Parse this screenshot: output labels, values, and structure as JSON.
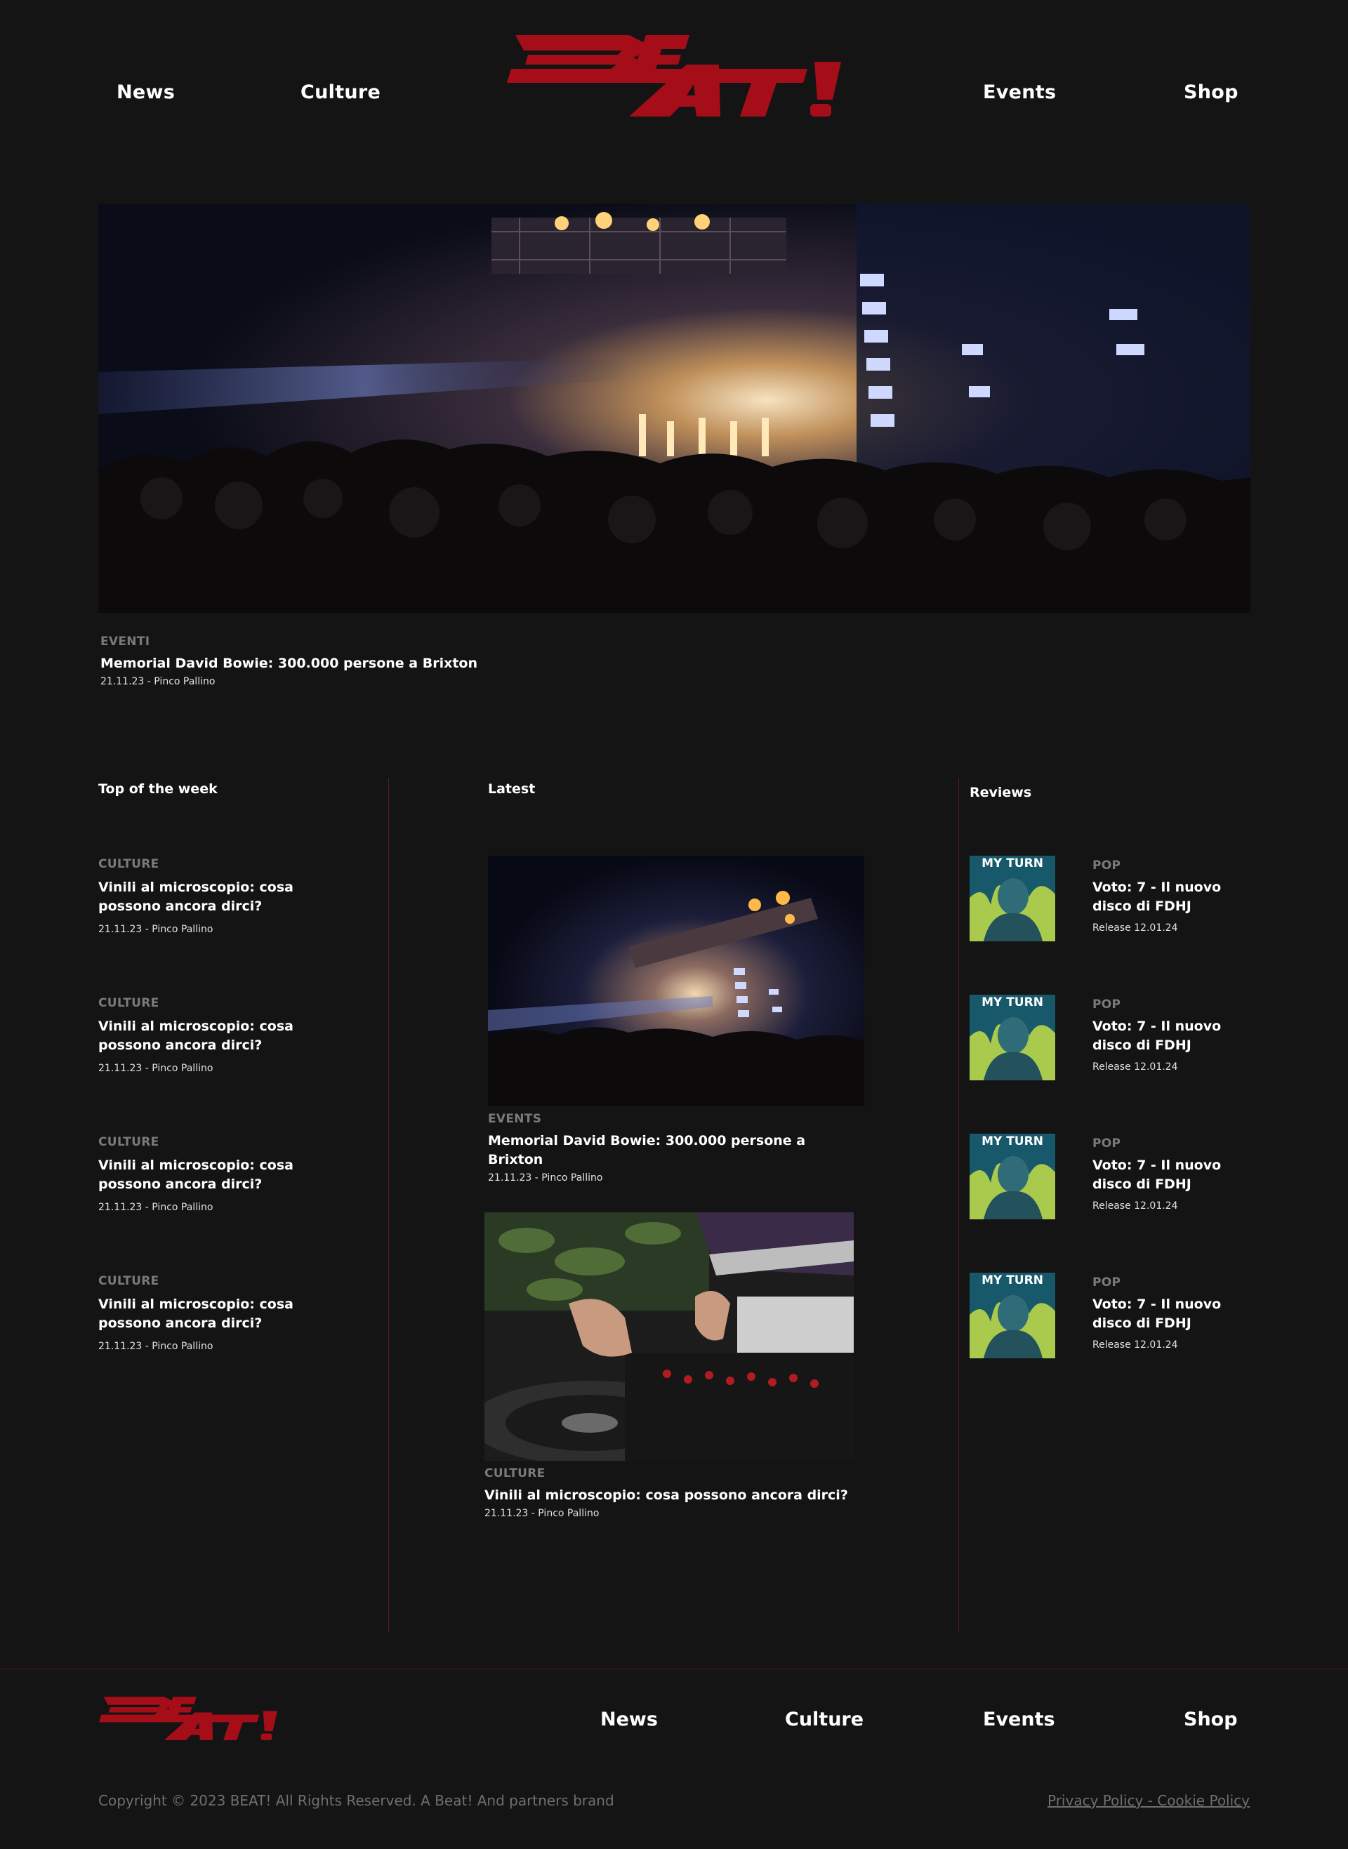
{
  "brand": {
    "logo_text": "BEAT!",
    "accent_color": "#a50d18",
    "background": "#141414"
  },
  "header": {
    "nav": [
      {
        "label": "News"
      },
      {
        "label": "Culture"
      },
      {
        "label": "Events"
      },
      {
        "label": "Shop"
      }
    ]
  },
  "hero": {
    "category": "EVENTI",
    "title": "Memorial David Bowie: 300.000 persone a Brixton",
    "meta": "21.11.23 - Pinco Pallino",
    "image": "concert-crowd-photo"
  },
  "top_of_week": {
    "heading": "Top of the week",
    "items": [
      {
        "category": "CULTURE",
        "title": "Vinili al microscopio: cosa possono ancora dirci?",
        "meta": "21.11.23 - Pinco Pallino"
      },
      {
        "category": "CULTURE",
        "title": "Vinili al microscopio: cosa possono ancora dirci?",
        "meta": "21.11.23 - Pinco Pallino"
      },
      {
        "category": "CULTURE",
        "title": "Vinili al microscopio: cosa possono ancora dirci?",
        "meta": "21.11.23 - Pinco Pallino"
      },
      {
        "category": "CULTURE",
        "title": "Vinili al microscopio: cosa possono ancora dirci?",
        "meta": "21.11.23 - Pinco Pallino"
      }
    ]
  },
  "latest": {
    "heading": "Latest",
    "items": [
      {
        "category": "EVENTS",
        "title": "Memorial David Bowie: 300.000 persone a Brixton",
        "meta": "21.11.23 - Pinco Pallino",
        "image": "concert-stage-photo"
      },
      {
        "category": "CULTURE",
        "title": "Vinili al microscopio: cosa possono ancora dirci?",
        "meta": "21.11.23 - Pinco Pallino",
        "image": "dj-turntable-photo"
      }
    ]
  },
  "reviews": {
    "heading": "Reviews",
    "items": [
      {
        "category": "POP",
        "title": "Voto: 7 - Il nuovo disco di FDHJ",
        "meta": "Release 12.01.24",
        "cover_text": "MY TURN"
      },
      {
        "category": "POP",
        "title": "Voto: 7 - Il nuovo disco di FDHJ",
        "meta": "Release 12.01.24",
        "cover_text": "MY TURN"
      },
      {
        "category": "POP",
        "title": "Voto: 7 - Il nuovo disco di FDHJ",
        "meta": "Release 12.01.24",
        "cover_text": "MY TURN"
      },
      {
        "category": "POP",
        "title": "Voto: 7 - Il nuovo disco di FDHJ",
        "meta": "Release 12.01.24",
        "cover_text": "MY TURN"
      }
    ]
  },
  "footer": {
    "nav": [
      {
        "label": "News"
      },
      {
        "label": "Culture"
      },
      {
        "label": "Events"
      },
      {
        "label": "Shop"
      }
    ],
    "copyright": "Copyright © 2023 BEAT! All Rights Reserved. A Beat! And partners brand",
    "policy_link": "Privacy Policy - Cookie Policy"
  }
}
